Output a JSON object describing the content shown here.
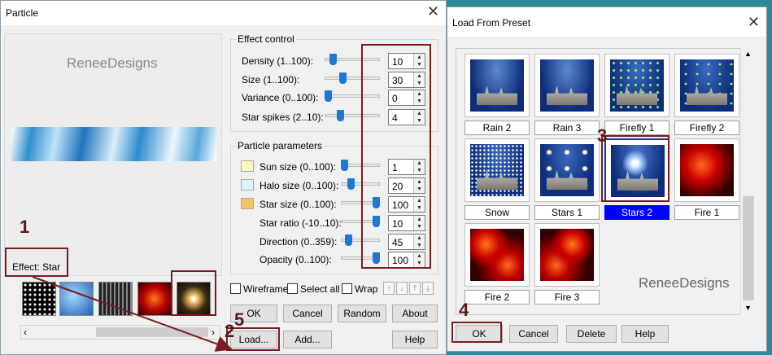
{
  "particle": {
    "title": "Particle",
    "watermark": "ReneeDesigns",
    "effect_label": "Effect: Star",
    "effect_control_title": "Effect control",
    "particle_params_title": "Particle parameters",
    "controls": [
      {
        "label": "Density (1..100):",
        "value": "10",
        "level": 0.1
      },
      {
        "label": "Size (1..100):",
        "value": "30",
        "level": 0.3
      },
      {
        "label": "Variance (0..100):",
        "value": "0",
        "level": 0.0
      },
      {
        "label": "Star spikes (2..10):",
        "value": "4",
        "level": 0.25
      }
    ],
    "params": [
      {
        "label": "Sun size (0..100):",
        "value": "1",
        "level": 0.01,
        "swatch": "#fff7c2"
      },
      {
        "label": "Halo size (0..100):",
        "value": "20",
        "level": 0.2,
        "swatch": "#d9f5fb"
      },
      {
        "label": "Star size (0..100):",
        "value": "100",
        "level": 1.0,
        "swatch": "#f6c26a"
      },
      {
        "label": "Star ratio (-10..10):",
        "value": "10",
        "level": 1.0
      },
      {
        "label": "Direction (0..359):",
        "value": "45",
        "level": 0.125
      },
      {
        "label": "Opacity (0..100):",
        "value": "100",
        "level": 1.0
      }
    ],
    "wireframe": "Wireframe",
    "select_all": "Select all",
    "wrap": "Wrap",
    "ok": "OK",
    "cancel": "Cancel",
    "random": "Random",
    "about": "About",
    "load": "Load...",
    "add": "Add...",
    "help": "Help"
  },
  "preset": {
    "title": "Load From Preset",
    "watermark": "ReneeDesigns",
    "items": [
      "Rain 2",
      "Rain 3",
      "Firefly 1",
      "Firefly 2",
      "Snow",
      "Stars 1",
      "Stars 2",
      "Fire 1",
      "Fire 2",
      "Fire 3"
    ],
    "selected": "Stars 2",
    "ok": "OK",
    "cancel": "Cancel",
    "delete": "Delete",
    "help": "Help"
  },
  "annotations": [
    "1",
    "2",
    "3",
    "4",
    "5"
  ],
  "colors": {
    "accent": "#1c78d2",
    "annotation": "#7a1c22",
    "selected": "#0000ff"
  }
}
